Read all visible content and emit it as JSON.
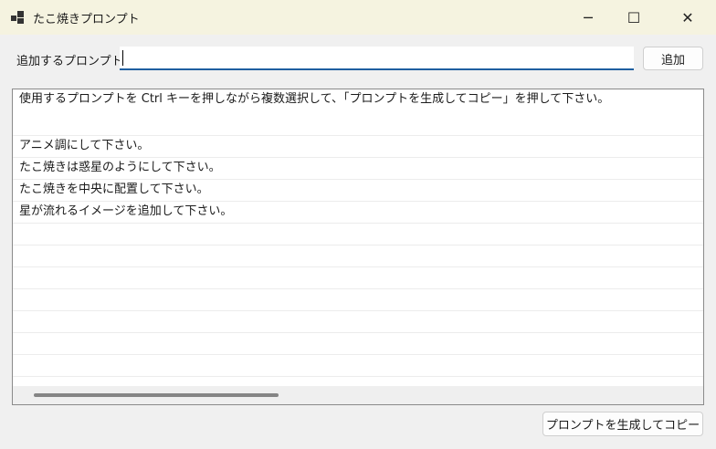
{
  "window": {
    "title": "たこ焼きプロンプト",
    "icon": "app-icon",
    "minimize": "─",
    "maximize": "☐",
    "close": "✕"
  },
  "form": {
    "label": "追加するプロンプト",
    "input_value": "",
    "add_button": "追加"
  },
  "list": {
    "items": [
      "使用するプロンプトを Ctrl キーを押しながら複数選択して、「プロンプトを生成してコピー」を押して下さい。",
      "アニメ調にして下さい。",
      "たこ焼きは惑星のようにして下さい。",
      "たこ焼きを中央に配置して下さい。",
      "星が流れるイメージを追加して下さい。"
    ]
  },
  "footer": {
    "generate_button": "プロンプトを生成してコピー"
  }
}
